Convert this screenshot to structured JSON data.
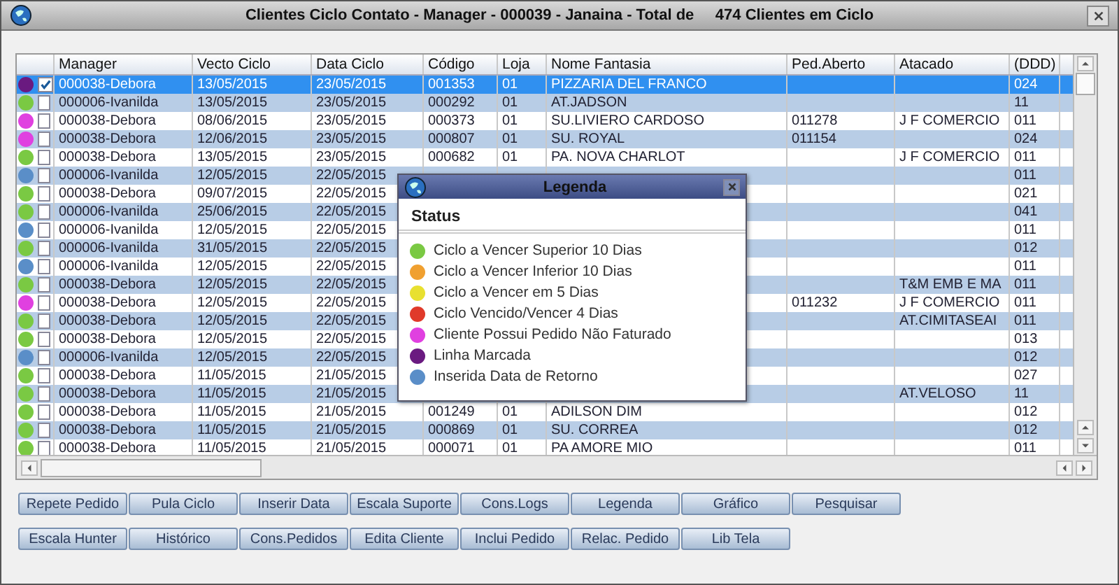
{
  "window": {
    "title": "Clientes Ciclo Contato - Manager - 000039 - Janaina - Total de     474 Clientes em Ciclo"
  },
  "table": {
    "columns": [
      "Manager",
      "Vecto Ciclo",
      "Data Ciclo",
      "Código",
      "Loja",
      "Nome Fantasia",
      "Ped.Aberto",
      "Atacado",
      "(DDD)"
    ],
    "rows": [
      {
        "color": "#6a1a80",
        "checked": true,
        "selected": true,
        "manager": "000038-Debora",
        "vecto_ciclo": "13/05/2015",
        "data_ciclo": "23/05/2015",
        "codigo": "001353",
        "loja": "01",
        "nome_fantasia": "PIZZARIA DEL FRANCO",
        "ddd": "024"
      },
      {
        "color": "#7ac943",
        "checked": false,
        "selected": false,
        "manager": "000006-Ivanilda",
        "vecto_ciclo": "13/05/2015",
        "data_ciclo": "23/05/2015",
        "codigo": "000292",
        "loja": "01",
        "nome_fantasia": "AT.JADSON",
        "ddd": "11"
      },
      {
        "color": "#e040e0",
        "checked": false,
        "selected": false,
        "manager": "000038-Debora",
        "vecto_ciclo": "08/06/2015",
        "data_ciclo": "23/05/2015",
        "codigo": "000373",
        "loja": "01",
        "nome_fantasia": "SU.LIVIERO CARDOSO",
        "ped_aberto": "011278",
        "atacado": "J F COMERCIO",
        "ddd": "011"
      },
      {
        "color": "#e040e0",
        "checked": false,
        "selected": false,
        "manager": "000038-Debora",
        "vecto_ciclo": "12/06/2015",
        "data_ciclo": "23/05/2015",
        "codigo": "000807",
        "loja": "01",
        "nome_fantasia": "SU. ROYAL",
        "ped_aberto": "011154",
        "ddd": "024"
      },
      {
        "color": "#7ac943",
        "checked": false,
        "selected": false,
        "manager": "000038-Debora",
        "vecto_ciclo": "13/05/2015",
        "data_ciclo": "23/05/2015",
        "codigo": "000682",
        "loja": "01",
        "nome_fantasia": "PA. NOVA CHARLOT",
        "atacado": "J F COMERCIO",
        "ddd": "011"
      },
      {
        "color": "#5a8ec8",
        "checked": false,
        "selected": false,
        "manager": "000006-Ivanilda",
        "vecto_ciclo": "12/05/2015",
        "data_ciclo": "22/05/2015",
        "ddd": "011"
      },
      {
        "color": "#7ac943",
        "checked": false,
        "selected": false,
        "manager": "000038-Debora",
        "vecto_ciclo": "09/07/2015",
        "data_ciclo": "22/05/2015",
        "ddd": "021"
      },
      {
        "color": "#7ac943",
        "checked": false,
        "selected": false,
        "manager": "000006-Ivanilda",
        "vecto_ciclo": "25/06/2015",
        "data_ciclo": "22/05/2015",
        "ddd": "041"
      },
      {
        "color": "#5a8ec8",
        "checked": false,
        "selected": false,
        "manager": "000006-Ivanilda",
        "vecto_ciclo": "12/05/2015",
        "data_ciclo": "22/05/2015",
        "ddd": "011"
      },
      {
        "color": "#7ac943",
        "checked": false,
        "selected": false,
        "manager": "000006-Ivanilda",
        "vecto_ciclo": "31/05/2015",
        "data_ciclo": "22/05/2015",
        "ddd": "012"
      },
      {
        "color": "#5a8ec8",
        "checked": false,
        "selected": false,
        "manager": "000006-Ivanilda",
        "vecto_ciclo": "12/05/2015",
        "data_ciclo": "22/05/2015",
        "ddd": "011"
      },
      {
        "color": "#7ac943",
        "checked": false,
        "selected": false,
        "manager": "000038-Debora",
        "vecto_ciclo": "12/05/2015",
        "data_ciclo": "22/05/2015",
        "atacado": "T&M EMB E MA",
        "ddd": "011"
      },
      {
        "color": "#e040e0",
        "checked": false,
        "selected": false,
        "manager": "000038-Debora",
        "vecto_ciclo": "12/05/2015",
        "data_ciclo": "22/05/2015",
        "ped_aberto": "011232",
        "atacado": "J F COMERCIO",
        "ddd": "011"
      },
      {
        "color": "#7ac943",
        "checked": false,
        "selected": false,
        "manager": "000038-Debora",
        "vecto_ciclo": "12/05/2015",
        "data_ciclo": "22/05/2015",
        "atacado": "AT.CIMITASEAI",
        "ddd": "011"
      },
      {
        "color": "#7ac943",
        "checked": false,
        "selected": false,
        "manager": "000038-Debora",
        "vecto_ciclo": "12/05/2015",
        "data_ciclo": "22/05/2015",
        "ddd": "013"
      },
      {
        "color": "#5a8ec8",
        "checked": false,
        "selected": false,
        "manager": "000006-Ivanilda",
        "vecto_ciclo": "12/05/2015",
        "data_ciclo": "22/05/2015",
        "ddd": "012"
      },
      {
        "color": "#7ac943",
        "checked": false,
        "selected": false,
        "manager": "000038-Debora",
        "vecto_ciclo": "11/05/2015",
        "data_ciclo": "21/05/2015",
        "ddd": "027"
      },
      {
        "color": "#7ac943",
        "checked": false,
        "selected": false,
        "manager": "000038-Debora",
        "vecto_ciclo": "11/05/2015",
        "data_ciclo": "21/05/2015",
        "atacado": "AT.VELOSO",
        "ddd": "11"
      },
      {
        "color": "#7ac943",
        "checked": false,
        "selected": false,
        "manager": "000038-Debora",
        "vecto_ciclo": "11/05/2015",
        "data_ciclo": "21/05/2015",
        "codigo": "001249",
        "loja": "01",
        "nome_fantasia": "ADILSON DIM",
        "ddd": "012"
      },
      {
        "color": "#7ac943",
        "checked": false,
        "selected": false,
        "manager": "000038-Debora",
        "vecto_ciclo": "11/05/2015",
        "data_ciclo": "21/05/2015",
        "codigo": "000869",
        "loja": "01",
        "nome_fantasia": "SU. CORREA",
        "ddd": "012"
      },
      {
        "color": "#7ac943",
        "checked": false,
        "selected": false,
        "manager": "000038-Debora",
        "vecto_ciclo": "11/05/2015",
        "data_ciclo": "21/05/2015",
        "codigo": "000071",
        "loja": "01",
        "nome_fantasia": "PA AMORE MIO",
        "ddd": "011"
      }
    ]
  },
  "legend_dialog": {
    "title": "Legenda",
    "heading": "Status",
    "items": [
      {
        "label": "Ciclo a Vencer Superior 10 Dias",
        "color": "#7ac943"
      },
      {
        "label": "Ciclo a Vencer Inferior 10 Dias",
        "color": "#f0a030"
      },
      {
        "label": "Ciclo a Vencer em 5 Dias",
        "color": "#e8e030"
      },
      {
        "label": "Ciclo Vencido/Vencer 4 Dias",
        "color": "#e03a2a"
      },
      {
        "label": "Cliente Possui Pedido Não Faturado",
        "color": "#e040e0"
      },
      {
        "label": "Linha Marcada",
        "color": "#6a1a80"
      },
      {
        "label": "Inserida Data de Retorno",
        "color": "#5a8ec8"
      }
    ]
  },
  "button_rows": [
    [
      "Repete Pedido",
      "Pula Ciclo",
      "Inserir Data",
      "Escala Suporte",
      "Cons.Logs",
      "Legenda",
      "Gráfico",
      "Pesquisar"
    ],
    [
      "Escala Hunter",
      "Histórico",
      "Cons.Pedidos",
      "Edita Cliente",
      "Inclui Pedido",
      "Relac. Pedido",
      "Lib Tela"
    ]
  ]
}
